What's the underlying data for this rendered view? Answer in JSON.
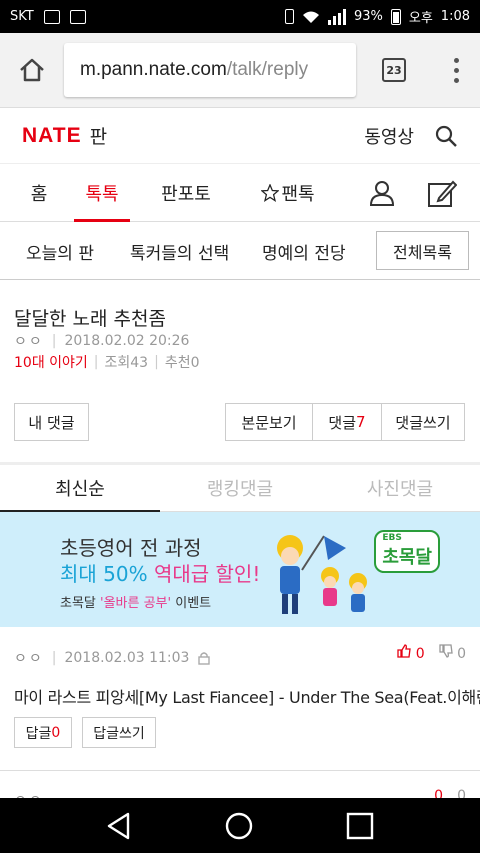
{
  "status_bar": {
    "carrier": "SKT",
    "battery": "93%",
    "ampm": "오후",
    "time": "1:08"
  },
  "browser": {
    "url_host": "m.pann.nate.com",
    "url_path": "/talk/reply",
    "tab_count": "23"
  },
  "header": {
    "logo": "NATE",
    "logo_sub": "판",
    "video": "동영상"
  },
  "main_nav": {
    "items": [
      {
        "label": "홈"
      },
      {
        "label": "톡톡"
      },
      {
        "label": "판포토"
      },
      {
        "label": "팬톡"
      }
    ]
  },
  "sub_nav": {
    "items": [
      {
        "label": "오늘의 판"
      },
      {
        "label": "톡커들의 선택"
      },
      {
        "label": "명예의 전당"
      }
    ],
    "all_list": "전체목록"
  },
  "post": {
    "title": "달달한 노래 추천좀",
    "author": "ㅇㅇ",
    "date": "2018.02.02 20:26",
    "category": "10대 이야기",
    "views": "조회43",
    "recommends": "추천0"
  },
  "actions": {
    "my_comments": "내 댓글",
    "view_post": "본문보기",
    "comments_label": "댓글",
    "comments_count": "7",
    "write_comment": "댓글쓰기"
  },
  "sort_tabs": [
    {
      "label": "최신순"
    },
    {
      "label": "랭킹댓글"
    },
    {
      "label": "사진댓글"
    }
  ],
  "banner": {
    "line1": "초등영어 전 과정",
    "line2_a": "최대 50% ",
    "line2_b": "역대급 할인!",
    "line3_a": "초목달 ",
    "line3_b": "'올바른 공부'",
    "line3_c": " 이벤트",
    "brand": "초목달",
    "brand_top": "EBS"
  },
  "comments": [
    {
      "author": "ㅇㅇ",
      "date": "2018.02.03 11:03",
      "up": "0",
      "down": "0",
      "text": "마이 라스트 피앙세[My Last Fiancee] - Under The Sea(Feat.이해린)",
      "reply_label": "답글",
      "reply_count": "0",
      "write_reply": "답글쓰기"
    },
    {
      "author": "ㅇㅇ",
      "up": "0",
      "down": "0"
    }
  ],
  "colors": {
    "brand_red": "#e60012",
    "banner_bg": "#cfeefb",
    "banner_blue": "#1aa3d6",
    "banner_pink": "#e8398a"
  }
}
